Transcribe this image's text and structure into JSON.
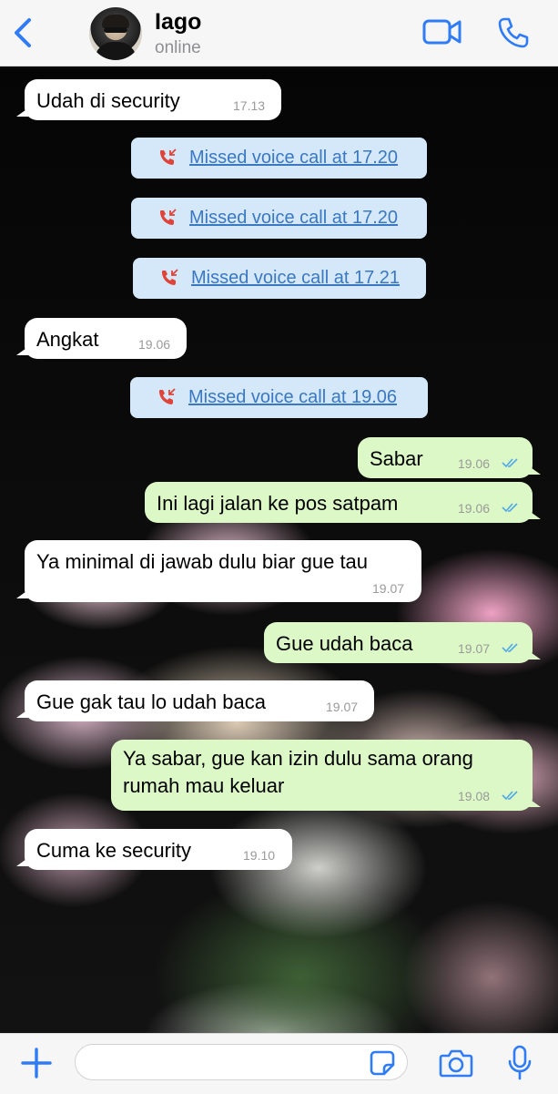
{
  "header": {
    "back_icon": "chevron-left-icon",
    "contact_name": "Iago",
    "status": "online",
    "video_icon": "video-camera-icon",
    "call_icon": "phone-icon"
  },
  "messages": [
    {
      "dir": "in",
      "text": "Udah di security",
      "time": "17.13"
    },
    {
      "type": "missed_call",
      "text": "Missed voice call at 17.20"
    },
    {
      "type": "missed_call",
      "text": "Missed voice call at 17.20"
    },
    {
      "type": "missed_call",
      "text": "Missed voice call at 17.21"
    },
    {
      "dir": "in",
      "text": "Angkat",
      "time": "19.06"
    },
    {
      "type": "missed_call",
      "text": "Missed voice call at 19.06"
    },
    {
      "dir": "out",
      "text": "Sabar",
      "time": "19.06",
      "read": true
    },
    {
      "dir": "out",
      "text": "Ini lagi jalan ke pos satpam",
      "time": "19.06",
      "read": true
    },
    {
      "dir": "in",
      "text": "Ya minimal di jawab dulu biar gue tau",
      "time": "19.07"
    },
    {
      "dir": "out",
      "text": "Gue udah baca",
      "time": "19.07",
      "read": true
    },
    {
      "dir": "in",
      "text": "Gue gak tau lo udah baca",
      "time": "19.07"
    },
    {
      "dir": "out",
      "text": "Ya sabar, gue kan izin dulu sama orang rumah mau keluar",
      "time": "19.08",
      "read": true
    },
    {
      "dir": "in",
      "text": "Cuma ke security",
      "time": "19.10"
    }
  ],
  "composer": {
    "input_value": "",
    "plus_icon": "plus-icon",
    "sticker_icon": "sticker-icon",
    "camera_icon": "camera-icon",
    "mic_icon": "microphone-icon"
  },
  "colors": {
    "accent": "#2f7cf6",
    "incoming_bubble": "#ffffff",
    "outgoing_bubble": "#dcf8c6",
    "system_bubble": "#d4e8f9",
    "missed_call_icon": "#e0433a",
    "read_ticks": "#4fa8e8",
    "link": "#3a78c2"
  }
}
